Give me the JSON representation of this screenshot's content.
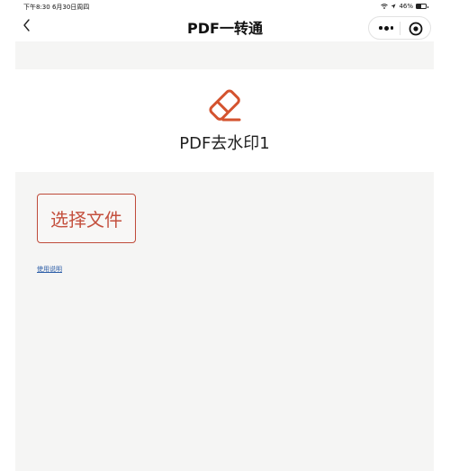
{
  "status_bar": {
    "time_date": "下午8:30  6月30日周四",
    "battery_percent": "46%",
    "battery_level": 0.46
  },
  "nav": {
    "title": "PDF一转通"
  },
  "tool": {
    "title": "PDF去水印1",
    "icon": "eraser-icon",
    "accent_color": "#d4532f"
  },
  "actions": {
    "select_file_label": "选择文件",
    "help_link": "使用说明"
  },
  "colors": {
    "button_border": "#bf4b3a",
    "link": "#2e5fa8",
    "panel_bg": "#f5f5f4"
  }
}
